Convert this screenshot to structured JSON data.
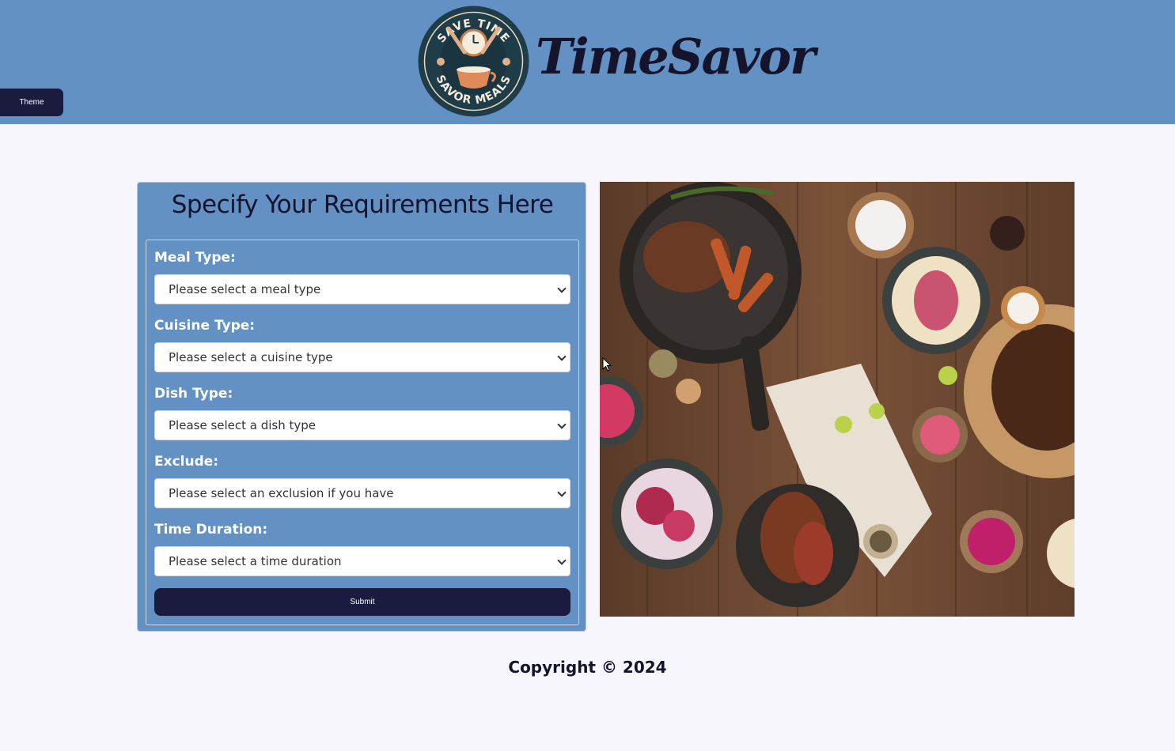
{
  "header": {
    "theme_label": "Theme",
    "brand": "TimeSavor",
    "logo": {
      "top_text": "SAVE TIME",
      "bottom_text": "SAVOR MEALS"
    }
  },
  "form": {
    "title": "Specify Your Requirements Here",
    "fields": [
      {
        "label": "Meal Type:",
        "value": "Please select a meal type"
      },
      {
        "label": "Cuisine Type:",
        "value": "Please select a cuisine type"
      },
      {
        "label": "Dish Type:",
        "value": "Please select a dish type"
      },
      {
        "label": "Exclude:",
        "value": "Please select an exclusion if you have"
      },
      {
        "label": "Time Duration:",
        "value": "Please select a time duration"
      }
    ],
    "submit_label": "Submit"
  },
  "footer": {
    "copyright": "Copyright © 2024"
  },
  "colors": {
    "header_bg": "#6391c4",
    "accent_dark": "#1b1b40",
    "page_bg": "#f7f6fc"
  }
}
